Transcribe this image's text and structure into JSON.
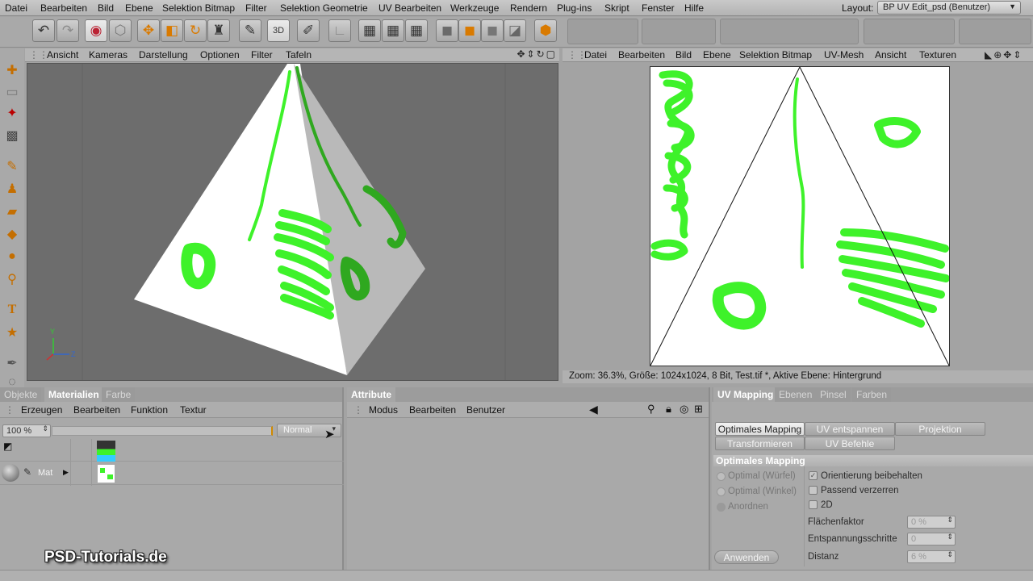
{
  "menubar": {
    "items": [
      "Datei",
      "Bearbeiten",
      "Bild",
      "Ebene",
      "Selektion Bitmap",
      "Filter",
      "Selektion Geometrie",
      "UV Bearbeiten",
      "Werkzeuge",
      "Rendern",
      "Plug-ins",
      "Skript",
      "Fenster",
      "Hilfe"
    ],
    "layout_label": "Layout:",
    "layout_value": "BP UV Edit_psd (Benutzer)"
  },
  "toolbar": {
    "icons": [
      "undo-icon",
      "redo-icon",
      "live-select-icon",
      "select-3d-icon",
      "move-icon",
      "scale-icon",
      "rotate-icon",
      "texture-axis-icon",
      "brush-icon",
      "brush-3d-icon",
      "brush-guitar-icon",
      "ruler-icon",
      "checker-icon",
      "checker2-icon",
      "checker3-icon",
      "cube-icon",
      "cube-orange-icon",
      "cube-grey-icon",
      "cube-edge-icon",
      "hex-icon"
    ],
    "brush3d_label": "3D"
  },
  "viewport": {
    "menu": [
      "Ansicht",
      "Kameras",
      "Darstellung",
      "Optionen",
      "Filter",
      "Tafeln"
    ],
    "axis_y": "Y",
    "axis_z": "Z"
  },
  "uv_editor": {
    "menu": [
      "Datei",
      "Bearbeiten",
      "Bild",
      "Ebene",
      "Selektion Bitmap",
      "UV-Mesh",
      "Ansicht",
      "Texturen"
    ],
    "status": "Zoom: 36.3%, Größe: 1024x1024, 8 Bit, Test.tif *, Aktive Ebene: Hintergrund"
  },
  "materials_panel": {
    "tabs": [
      "Objekte",
      "Materialien",
      "Farbe"
    ],
    "active_tab": "Materialien",
    "menu": [
      "Erzeugen",
      "Bearbeiten",
      "Funktion",
      "Textur"
    ],
    "opacity_value": "100 %",
    "blend_mode": "Normal",
    "material_name": "Mat"
  },
  "attribute_panel": {
    "tab": "Attribute",
    "menu": [
      "Modus",
      "Bearbeiten",
      "Benutzer"
    ]
  },
  "uv_mapping_panel": {
    "tabs": [
      "UV Mapping",
      "Ebenen",
      "Pinsel",
      "Farben"
    ],
    "active_tab": "UV Mapping",
    "buttons_row1": [
      "Optimales Mapping",
      "UV entspannen",
      "Projektion"
    ],
    "buttons_row2": [
      "Transformieren",
      "UV Befehle"
    ],
    "section_title": "Optimales Mapping",
    "radio_options": [
      "Optimal (Würfel)",
      "Optimal (Winkel)",
      "Anordnen"
    ],
    "checkboxes": [
      {
        "label": "Orientierung beibehalten",
        "checked": true
      },
      {
        "label": "Passend verzerren",
        "checked": false
      },
      {
        "label": "2D",
        "checked": false
      }
    ],
    "fields": [
      {
        "label": "Flächenfaktor",
        "value": "0 %"
      },
      {
        "label": "Entspannungsschritte",
        "value": "0"
      },
      {
        "label": "Distanz",
        "value": "6 %"
      }
    ],
    "apply_button": "Anwenden"
  },
  "watermark": "PSD-Tutorials.de",
  "colors": {
    "paint_green": "#3ef22a",
    "paint_dark_green": "#2fa81f",
    "ui_grey": "#a9a9a9",
    "viewport_bg": "#6d6d6d"
  }
}
